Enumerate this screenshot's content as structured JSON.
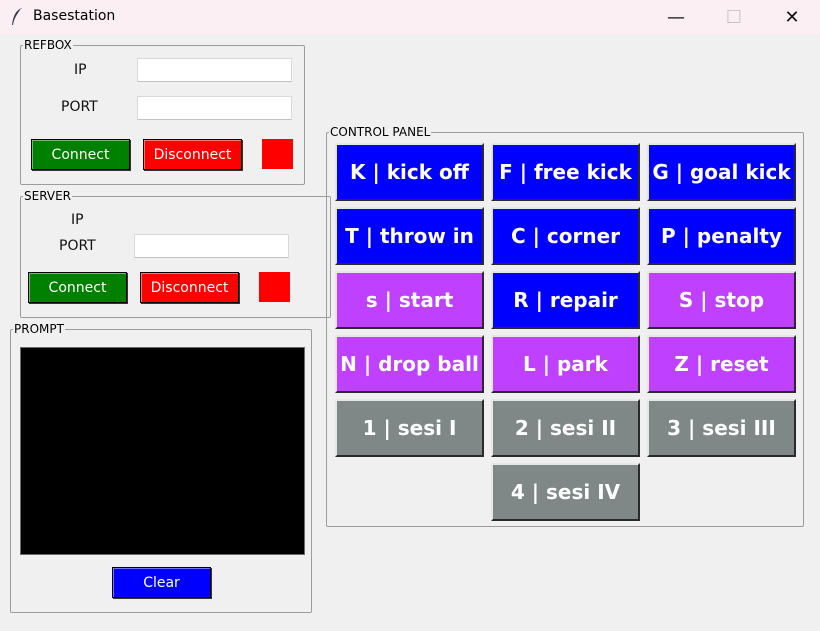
{
  "window": {
    "title": "Basestation",
    "minimize": "—",
    "maximize": "☐",
    "close": "✕"
  },
  "refbox": {
    "legend": "REFBOX",
    "ip_label": "IP",
    "ip_value": "",
    "port_label": "PORT",
    "port_value": "",
    "connect_label": "Connect",
    "disconnect_label": "Disconnect",
    "status_color": "#ff0000"
  },
  "server": {
    "legend": "SERVER",
    "ip_label": "IP",
    "port_label": "PORT",
    "port_value": "",
    "connect_label": "Connect",
    "disconnect_label": "Disconnect",
    "status_color": "#ff0000"
  },
  "prompt": {
    "legend": "PROMPT",
    "content": "",
    "clear_label": "Clear"
  },
  "control_panel": {
    "legend": "CONTROL PANEL",
    "buttons": [
      {
        "label": "K | kick off",
        "color": "#0000ff"
      },
      {
        "label": "F | free kick",
        "color": "#0000ff"
      },
      {
        "label": "G | goal kick",
        "color": "#0000ff"
      },
      {
        "label": "T | throw in",
        "color": "#0000ff"
      },
      {
        "label": "C | corner",
        "color": "#0000ff"
      },
      {
        "label": "P | penalty",
        "color": "#0000ff"
      },
      {
        "label": "s | start",
        "color": "#bf40ff"
      },
      {
        "label": "R | repair",
        "color": "#0000ff"
      },
      {
        "label": "S | stop",
        "color": "#bf40ff"
      },
      {
        "label": "N | drop ball",
        "color": "#bf40ff"
      },
      {
        "label": "L | park",
        "color": "#bf40ff"
      },
      {
        "label": "Z | reset",
        "color": "#bf40ff"
      },
      {
        "label": "1 | sesi I",
        "color": "#7f8787"
      },
      {
        "label": "2 | sesi II",
        "color": "#7f8787"
      },
      {
        "label": "3 | sesi III",
        "color": "#7f8787"
      },
      {
        "label": "4 | sesi IV",
        "color": "#7f8787"
      }
    ]
  }
}
